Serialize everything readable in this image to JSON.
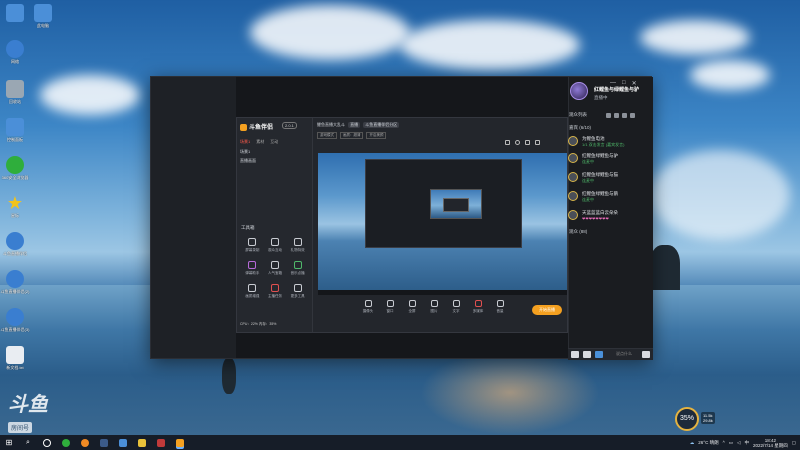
{
  "desktop": {
    "icons": [
      {
        "label": "",
        "color": "#4b8fd8"
      },
      {
        "label": "此电脑",
        "color": "#4b8fd8"
      },
      {
        "label": "网络",
        "color": "#3a7ed0"
      },
      {
        "label": "回收站",
        "color": "#9aa7b3"
      },
      {
        "label": "控制面板",
        "color": "#4b8fd8"
      },
      {
        "label": "360安全浏览器",
        "color": "#2fae3c"
      },
      {
        "label": "星标",
        "color": "#f2c31b"
      },
      {
        "label": "斗鱼直播伴侣",
        "color": "#3a7ed0"
      },
      {
        "label": "斗鱼直播伴侣(2)",
        "color": "#3a7ed0"
      },
      {
        "label": "斗鱼直播伴侣(3)",
        "color": "#3a7ed0"
      },
      {
        "label": "新文档.txt",
        "color": "#e9edf2"
      },
      {
        "label": "新建文本",
        "color": "#e9edf2"
      }
    ],
    "watermark": {
      "brand": "斗鱼",
      "room_label": "房间号",
      "room_number": "640262"
    }
  },
  "app": {
    "anchor_name": "红鲤鱼与绿鲤鱼与驴",
    "anchor_status": "直播中",
    "right_tabs": [
      "观众列表"
    ],
    "guest_section": "嘉宾 (6/10)",
    "guests": [
      {
        "name": "为鲤鱼电池",
        "status": "1/1 双击发言 (嘉宾发言)"
      },
      {
        "name": "红鲤鱼绿鲤鱼与驴",
        "status": "连麦中"
      },
      {
        "name": "红鲤鱼绿鲤鱼与猫",
        "status": "连麦中"
      },
      {
        "name": "红鲤鱼绿鲤鱼与鹅",
        "status": "连麦中"
      },
      {
        "name": "红鲤鱼绿鲤鱼与云",
        "status": "连麦中"
      },
      {
        "name": "天蓝蓝蓝白云朵朵",
        "status": "❤❤❤❤❤❤❤❤"
      }
    ],
    "audience_section": "观众 (88)",
    "chat_placeholder": "说点什么"
  },
  "inner": {
    "logo": "斗鱼伴侣",
    "version": "2.0.1",
    "tabs": [
      "场景1",
      "素材",
      "互动"
    ],
    "scenes": [
      "场景1",
      "直播画面"
    ],
    "top_title": "鲤鱼直播大乱斗",
    "top_tags": [
      "直播",
      "斗鱼直播伴侣分区"
    ],
    "top2_tags": [
      "游戏模式",
      "画质：超清",
      "开启美颜"
    ],
    "tools_title": "工具箱",
    "tools": [
      "屏幕录制",
      "观众互动",
      "礼物特效",
      "弹幕助手",
      "人气宝箱",
      "音乐点播",
      "画质增强",
      "主播任务",
      "更多工具"
    ],
    "bottom": [
      "摄像头",
      "窗口",
      "全屏",
      "图片",
      "文字",
      "多媒体",
      "音量"
    ],
    "go_live": "开始直播",
    "status": "CPU：22% 内存：35%"
  },
  "widget": {
    "value": "35%",
    "up": "11.5k",
    "down": "29.8k"
  },
  "taskbar": {
    "weather": "26°C 晴朗",
    "time": "18:42",
    "date": "2022/7/14 星期四",
    "lang": "中"
  },
  "window": {
    "minimize": "—",
    "maximize": "□",
    "close": "✕"
  }
}
